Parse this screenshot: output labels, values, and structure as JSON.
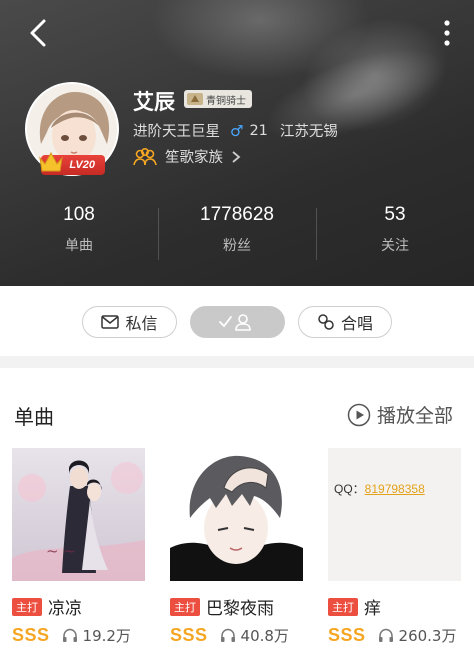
{
  "profile": {
    "name": "艾辰",
    "title_badge": "青铜骑士",
    "level": "LV20",
    "rank": "进阶天王巨星",
    "gender_symbol": "♂",
    "age": "21",
    "location": "江苏无锡",
    "family": "笙歌家族"
  },
  "stats": [
    {
      "value": "108",
      "label": "单曲"
    },
    {
      "value": "1778628",
      "label": "粉丝"
    },
    {
      "value": "53",
      "label": "关注"
    }
  ],
  "actions": {
    "message": "私信",
    "duet": "合唱"
  },
  "songs_section": {
    "title": "单曲",
    "play_all": "播放全部"
  },
  "songs": [
    {
      "tag": "主打",
      "name": "凉凉",
      "grade": "SSS",
      "plays": "19.2万"
    },
    {
      "tag": "主打",
      "name": "巴黎夜雨",
      "grade": "SSS",
      "plays": "40.8万"
    },
    {
      "tag": "主打",
      "name": "痒",
      "grade": "SSS",
      "plays": "260.3万"
    }
  ],
  "cover3": {
    "qq_label": "QQ：",
    "qq_number": "819798358"
  },
  "colors": {
    "accent_red": "#ec4e3f",
    "grade_gold": "#f5a623",
    "male_blue": "#4aa8ff"
  }
}
